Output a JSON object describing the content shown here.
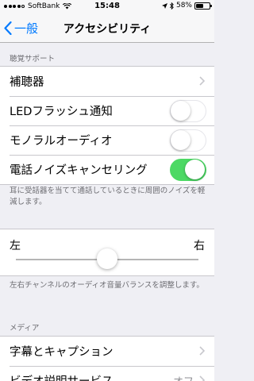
{
  "status_bar": {
    "carrier": "SoftBank",
    "time": "15:48",
    "battery": "58%",
    "battery_level": 0.58,
    "signal_strength": 4
  },
  "nav": {
    "back_label": "一般",
    "title": "アクセシビリティ"
  },
  "hearing": {
    "header": "聴覚サポート",
    "items": [
      {
        "label": "補聴器",
        "type": "disclosure"
      },
      {
        "label": "LEDフラッシュ通知",
        "type": "switch",
        "on": false
      },
      {
        "label": "モノラルオーディオ",
        "type": "switch",
        "on": false
      },
      {
        "label": "電話ノイズキャンセリング",
        "type": "switch",
        "on": true
      }
    ],
    "footer": "耳に受話器を当てて通話しているときに周囲のノイズを軽減します。"
  },
  "balance": {
    "left_label": "左",
    "right_label": "右",
    "value": 0.5,
    "footer": "左右チャンネルのオーディオ音量バランスを調整します。"
  },
  "media": {
    "header": "メディア",
    "items": [
      {
        "label": "字幕とキャプション",
        "type": "disclosure"
      },
      {
        "label": "ビデオ説明サービス",
        "detail": "オフ",
        "type": "disclosure"
      }
    ]
  },
  "colors": {
    "accent": "#007aff",
    "switch_on": "#4cd964",
    "background": "#efeff4"
  }
}
